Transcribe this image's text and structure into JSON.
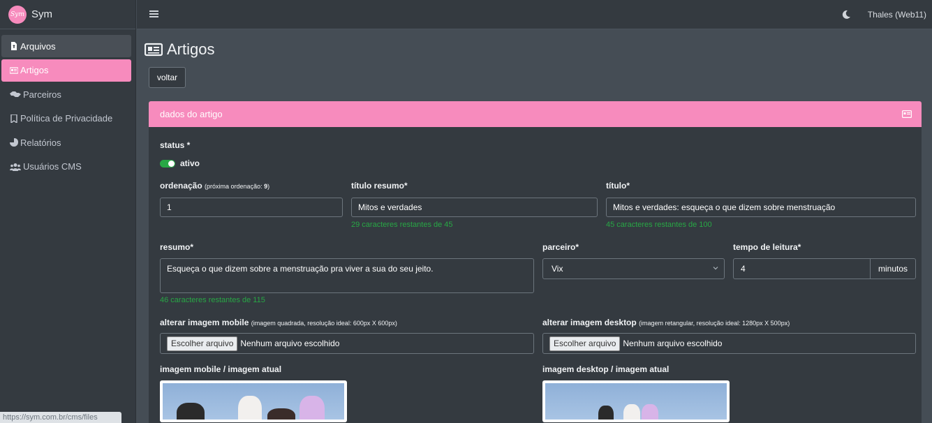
{
  "brand": {
    "logo_text": "Sym",
    "name": "Sym"
  },
  "sidebar": {
    "items": [
      {
        "label": "Arquivos",
        "icon": "file-upload-icon"
      },
      {
        "label": "Artigos",
        "icon": "newspaper-icon"
      },
      {
        "label": "Parceiros",
        "icon": "handshake-icon"
      },
      {
        "label": "Política de Privacidade",
        "icon": "bookmark-icon"
      },
      {
        "label": "Relatórios",
        "icon": "pie-chart-icon"
      },
      {
        "label": "Usuários CMS",
        "icon": "users-icon"
      }
    ]
  },
  "statusbar": {
    "url": "https://sym.com.br/cms/files"
  },
  "topbar": {
    "user": "Thales (Web11)"
  },
  "page": {
    "title": "Artigos",
    "back_label": "voltar"
  },
  "card": {
    "header": "dados do artigo",
    "status_label": "status *",
    "status_value": "ativo",
    "ordenacao_label": "ordenação",
    "ordenacao_note": "(próxima ordenação: ",
    "ordenacao_next": "9",
    "ordenacao_note_end": ")",
    "ordenacao_value": "1",
    "titulo_resumo_label": "título resumo*",
    "titulo_resumo_value": "Mitos e verdades",
    "titulo_resumo_hint": "29 caracteres restantes de 45",
    "titulo_label": "título*",
    "titulo_value": "Mitos e verdades: esqueça o que dizem sobre menstruação",
    "titulo_hint": "45 caracteres restantes de 100",
    "resumo_label": "resumo*",
    "resumo_value": "Esqueça o que dizem sobre a menstruação pra viver a sua do seu jeito.",
    "resumo_hint": "46 caracteres restantes de 115",
    "parceiro_label": "parceiro*",
    "parceiro_value": "Vix",
    "tempo_label": "tempo de leitura*",
    "tempo_value": "4",
    "tempo_unit": "minutos",
    "img_mobile_label": "alterar imagem mobile",
    "img_mobile_note": "(imagem quadrada, resolução ideal: 600px X 600px)",
    "img_desktop_label": "alterar imagem desktop",
    "img_desktop_note": "(imagem retangular, resolução ideal: 1280px X 500px)",
    "file_button": "Escolher arquivo",
    "file_none": "Nenhum arquivo escolhido",
    "mobile_current_label": "imagem mobile / imagem atual",
    "desktop_current_label": "imagem desktop / imagem atual"
  },
  "colors": {
    "accent": "#f78bbd",
    "success": "#28a745",
    "sidebar_bg": "#343a40",
    "content_bg": "#454d55"
  }
}
